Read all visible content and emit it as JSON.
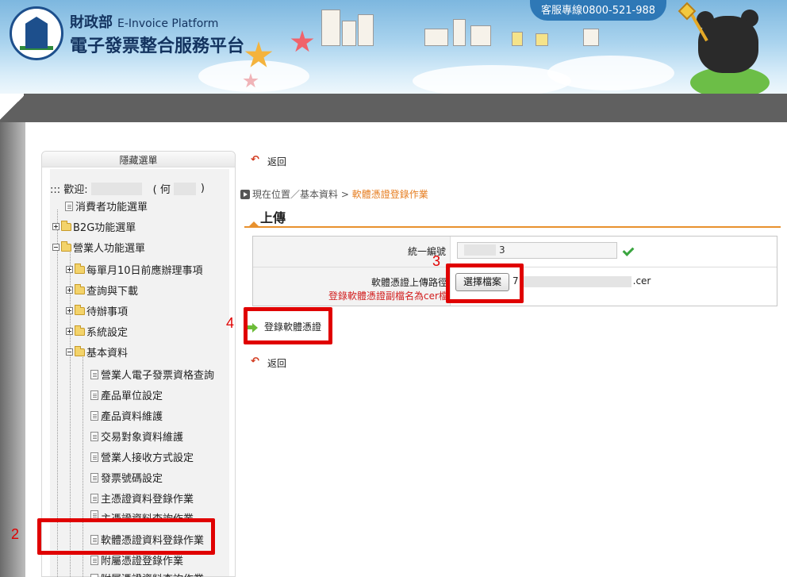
{
  "header": {
    "agency": "財政部",
    "platform_en": "E-Invoice Platform",
    "platform_zh": "電子發票整合服務平台",
    "hotline": "客服專線0800-521-988"
  },
  "sidebar": {
    "toggle_label": "隱藏選單",
    "welcome_prefix": "::: 歡迎:",
    "welcome_paren_open": "( 何",
    "welcome_paren_close": ")",
    "items": [
      {
        "label": "消費者功能選單"
      },
      {
        "label": "B2G功能選單"
      },
      {
        "label": "營業人功能選單"
      },
      {
        "label": "每單月10日前應辦理事項"
      },
      {
        "label": "查詢與下載"
      },
      {
        "label": "待辦事項"
      },
      {
        "label": "系統設定"
      },
      {
        "label": "基本資料"
      },
      {
        "label": "營業人電子發票資格查詢"
      },
      {
        "label": "產品單位設定"
      },
      {
        "label": "產品資料維護"
      },
      {
        "label": "交易對象資料維護"
      },
      {
        "label": "營業人接收方式設定"
      },
      {
        "label": "發票號碼設定"
      },
      {
        "label": "主憑證資料登錄作業"
      },
      {
        "label": "主憑證資料查詢作業"
      },
      {
        "label": "軟體憑證資料登錄作業"
      },
      {
        "label": "附屬憑證登錄作業"
      },
      {
        "label": "附屬憑證資料查詢作業"
      }
    ]
  },
  "main": {
    "back_label": "返回",
    "breadcrumb": {
      "prefix": "現在位置／基本資料 >",
      "current": "軟體憑證登錄作業"
    },
    "section_title": "上傳",
    "form": {
      "tax_id_label": "統一編號",
      "tax_id_value": "3",
      "path_label": "軟體憑證上傳路徑",
      "path_hint": "登錄軟體憑證副檔名為cer檔",
      "file_button": "選擇檔案",
      "file_name_prefix": "7",
      "file_name_suffix": ".cer"
    },
    "register_button": "登錄軟體憑證",
    "back_label_bottom": "返回"
  },
  "annotations": {
    "n2": "2",
    "n3": "3",
    "n4": "4",
    "color": "#e00000"
  }
}
